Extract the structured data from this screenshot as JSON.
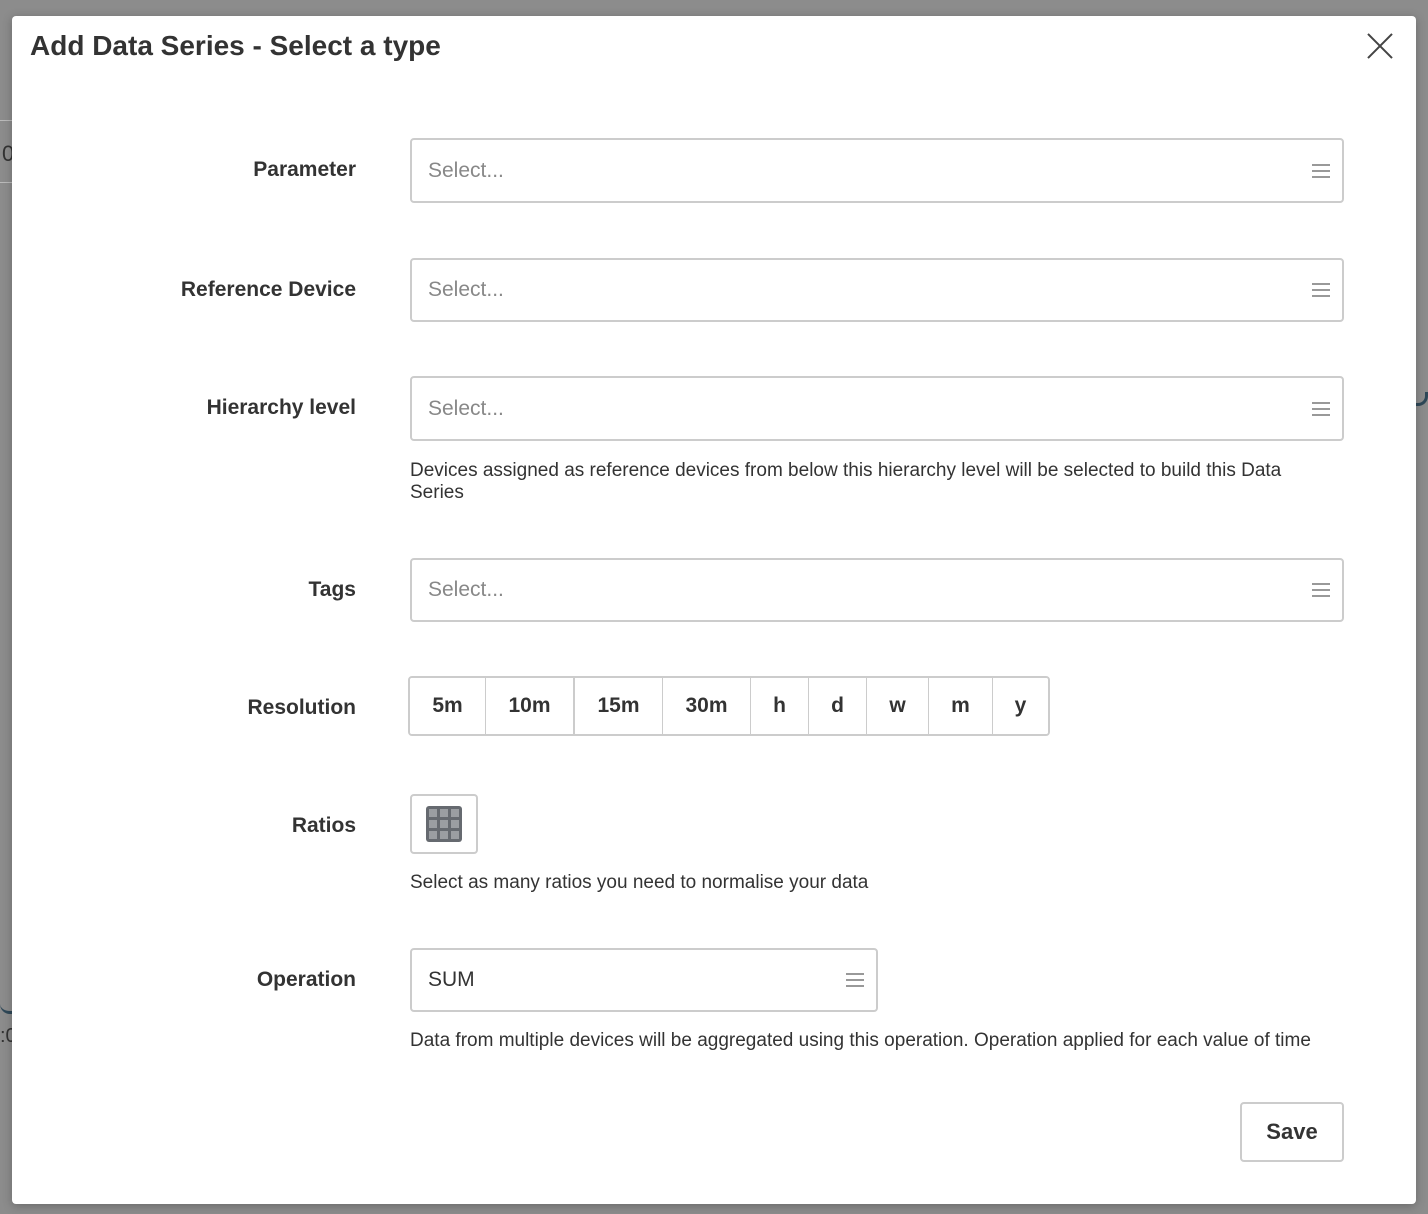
{
  "background": {
    "fragment_top": "0",
    "fragment_bottom": ":0"
  },
  "modal": {
    "title": "Add Data Series - Select a type",
    "close_icon": "close-icon"
  },
  "fields": {
    "parameter": {
      "label": "Parameter",
      "placeholder": "Select..."
    },
    "reference_device": {
      "label": "Reference Device",
      "placeholder": "Select..."
    },
    "hierarchy_level": {
      "label": "Hierarchy level",
      "placeholder": "Select...",
      "help": "Devices assigned as reference devices from below this hierarchy level will be selected to build this Data Series"
    },
    "tags": {
      "label": "Tags",
      "placeholder": "Select..."
    },
    "resolution": {
      "label": "Resolution",
      "options": [
        "5m",
        "10m",
        "15m",
        "30m",
        "h",
        "d",
        "w",
        "m",
        "y"
      ]
    },
    "ratios": {
      "label": "Ratios",
      "icon": "grid-icon",
      "help": "Select as many ratios you need to normalise your data"
    },
    "operation": {
      "label": "Operation",
      "value": "SUM",
      "help": "Data from multiple devices will be aggregated using this operation. Operation applied for each value of time"
    }
  },
  "actions": {
    "save_label": "Save"
  },
  "colors": {
    "border": "#cccccc",
    "text": "#333333",
    "placeholder": "#888888",
    "grid_icon": "#666a70"
  }
}
